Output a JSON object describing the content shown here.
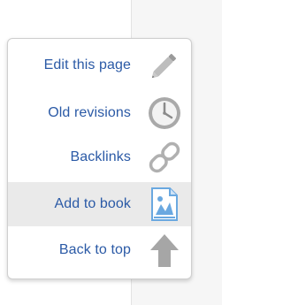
{
  "menu": {
    "items": [
      {
        "label": "Edit this page",
        "icon": "pencil-icon"
      },
      {
        "label": "Old revisions",
        "icon": "clock-icon"
      },
      {
        "label": "Backlinks",
        "icon": "chain-link-icon"
      },
      {
        "label": "Add to book",
        "icon": "add-to-book-icon"
      },
      {
        "label": "Back to top",
        "icon": "arrow-up-icon"
      }
    ]
  },
  "colors": {
    "link_text": "#2b5aa6",
    "active_background": "#eaeaea",
    "icon_gray": "#a6a6a6",
    "book_icon_blue": "#6aa8e0"
  }
}
